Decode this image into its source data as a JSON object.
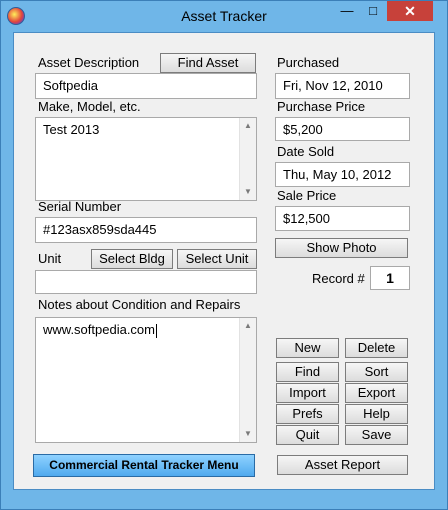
{
  "window": {
    "title": "Asset Tracker",
    "minimize_glyph": "—",
    "maximize_glyph": "□",
    "close_glyph": "✕",
    "icon": "app-logo-icon"
  },
  "form": {
    "asset_description_label": "Asset Description",
    "find_asset_button": "Find Asset",
    "asset_description_value": "Softpedia",
    "make_model_label": "Make, Model, etc.",
    "make_model_value": "Test 2013",
    "serial_number_label": "Serial Number",
    "serial_number_value": "#123asx859sda445",
    "unit_label": "Unit",
    "select_bldg_button": "Select Bldg",
    "select_unit_button": "Select Unit",
    "unit_value": "",
    "notes_label": "Notes about Condition and Repairs",
    "notes_value": "www.softpedia.com",
    "purchased_label": "Purchased",
    "purchased_value": "Fri, Nov 12, 2010",
    "purchase_price_label": "Purchase Price",
    "purchase_price_value": "$5,200",
    "date_sold_label": "Date Sold",
    "date_sold_value": "Thu, May 10, 2012",
    "sale_price_label": "Sale Price",
    "sale_price_value": "$12,500",
    "show_photo_button": "Show Photo",
    "record_label": "Record #",
    "record_value": "1"
  },
  "actions": {
    "new": "New",
    "delete": "Delete",
    "find": "Find",
    "sort": "Sort",
    "import": "Import",
    "export": "Export",
    "prefs": "Prefs",
    "help": "Help",
    "quit": "Quit",
    "save": "Save",
    "menu_button": "Commercial Rental Tracker Menu",
    "asset_report": "Asset Report"
  },
  "colors": {
    "frame": "#6fb6e8",
    "close": "#c7413a",
    "menu_button": "#4fa9ee"
  }
}
